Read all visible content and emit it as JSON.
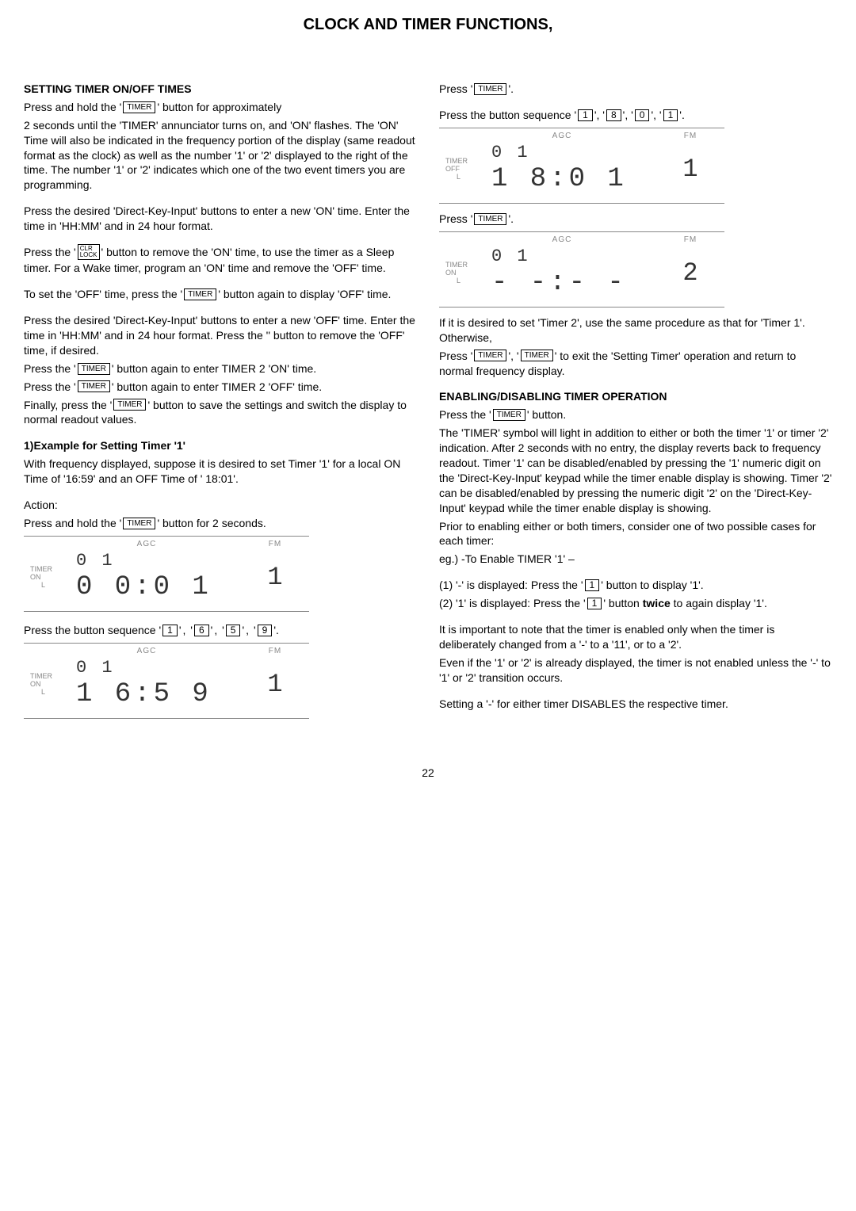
{
  "title": "CLOCK AND TIMER FUNCTIONS,",
  "buttons": {
    "timer": "TIMER",
    "clr": "CLR\nLOCK",
    "k1": "1",
    "k6": "6",
    "k5": "5",
    "k9": "9",
    "k8": "8",
    "k0": "0"
  },
  "left": {
    "h1": "SETTING TIMER ON/OFF TIMES",
    "p1a": "Press and hold the ",
    "p1b": " button for approximately",
    "p2": "2 seconds until the 'TIMER' annunciator turns on, and 'ON' flashes. The 'ON' Time will also be indicated in the frequency portion of the display (same readout format as the clock) as well as the number '1' or '2' displayed to the right of the time. The number '1' or '2' indicates which one of the two event timers you are programming.",
    "p3": "Press the desired 'Direct-Key-Input' buttons to enter a new 'ON' time. Enter the time in 'HH:MM' and in 24 hour format.",
    "p4a": "Press the ",
    "p4b": " button to remove the 'ON' time, to use the timer as a Sleep timer. For a Wake timer, program an 'ON' time and remove the 'OFF' time.",
    "p5a": "To set the 'OFF' time, press the ",
    "p5b": " button again to display 'OFF' time.",
    "p6": "Press the desired 'Direct-Key-Input' buttons to enter a new 'OFF' time. Enter the time in 'HH:MM' and in 24 hour format. Press the '' button to remove the 'OFF' time, if desired.",
    "p7a": "Press the ",
    "p7b": " button again to enter TIMER 2 'ON' time.",
    "p8a": "Press the ",
    "p8b": " button again to enter TIMER 2 'OFF' time.",
    "p9a": "Finally, press the ",
    "p9b": " button to save the settings and switch the display to normal readout values.",
    "h2": "1)Example for Setting Timer '1'",
    "p10": "With frequency displayed, suppose it is desired to set Timer '1' for a local ON Time of '16:59' and an OFF Time of ' 18:01'.",
    "action": "Action:",
    "p11a": "Press and hold the ",
    "p11b": " button for 2 seconds.",
    "p12": "Press the button sequence "
  },
  "right": {
    "p1": "Press ",
    "p2": "Press the button sequence ",
    "p3": "Press ",
    "p4": "If it is desired to set 'Timer 2', use the same procedure as that for 'Timer 1'. Otherwise,",
    "p5a": "Press ",
    "p5b": " to exit the 'Setting Timer' operation and return to normal frequency display.",
    "h1": "ENABLING/DISABLING TIMER OPERATION",
    "p6a": "Press the ",
    "p6b": " button.",
    "p7": "The 'TIMER' symbol will light in addition to either or both the timer '1' or timer '2' indication. After 2 seconds with no entry, the display reverts back to frequency readout. Timer '1' can be disabled/enabled by pressing the '1' numeric digit on the 'Direct-Key-Input' keypad while the timer enable display is showing. Timer '2' can be disabled/enabled by pressing the numeric digit '2' on the 'Direct-Key-Input' keypad while the timer enable display is showing.",
    "p8": "Prior to enabling either or both timers, consider one of two possible cases for each timer:",
    "p9": " eg.) -To Enable TIMER '1' –",
    "p10a": "(1) '-' is displayed: Press the ",
    "p10b": " button to display '1'.",
    "p11a": "(2) '1' is displayed: Press the ",
    "p11b": " button ",
    "p11c": "twice",
    "p11d": " to again display '1'.",
    "p12": "It is important to note that the timer is enabled only when the timer is deliberately changed from a '-' to a '11', or to a '2'.",
    "p13": "Even if the '1' or '2' is already displayed, the timer is not enabled unless the '-' to '1' or '2' transition occurs.",
    "p14": "Setting a '-' for either timer DISABLES the respective timer."
  },
  "lcd": {
    "agc": "AGC",
    "fm": "FM",
    "timerOn": "TIMER\nON",
    "timerOff": "TIMER\nOFF",
    "l": "L",
    "d1_small": "0 1",
    "d1_big": "0 0:0 1",
    "d1_r": "1",
    "d2_small": "0 1",
    "d2_big": "1 6:5 9",
    "d2_r": "1",
    "d3_small": "0 1",
    "d3_big": "1 8:0 1",
    "d3_r": "1",
    "d4_small": "0 1",
    "d4_big": "- -:- -",
    "d4_r": "2"
  },
  "pagenum": "22"
}
